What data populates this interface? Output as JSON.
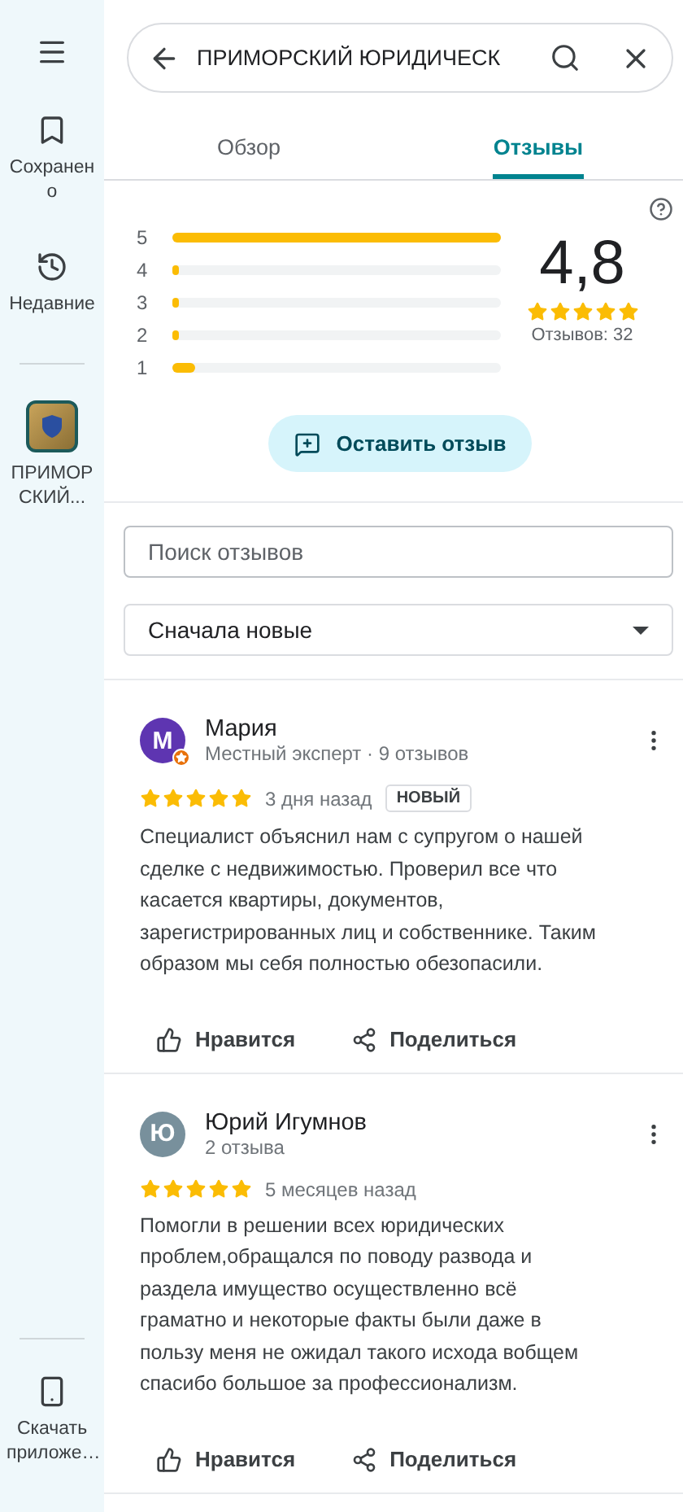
{
  "sidebar": {
    "items": [
      {
        "kind": "menu"
      },
      {
        "kind": "saved",
        "label": "Сохранено"
      },
      {
        "kind": "recent",
        "label": "Недавние"
      },
      {
        "kind": "place",
        "label": "ПРИМОРСКИЙ..."
      }
    ],
    "footer": {
      "label": "Скачать приложе…"
    }
  },
  "search": {
    "value": "ПРИМОРСКИЙ ЮРИДИЧЕСК"
  },
  "tabs": [
    {
      "label": "Обзор",
      "selected": false
    },
    {
      "label": "Отзывы",
      "selected": true
    }
  ],
  "summary": {
    "rating": "4,8",
    "stars": 5,
    "count": "Отзывов: 32",
    "bars": [
      {
        "label": "5",
        "level": 1.0
      },
      {
        "label": "4",
        "level": 0.02
      },
      {
        "label": "3",
        "level": 0.02
      },
      {
        "label": "2",
        "level": 0.02
      },
      {
        "label": "1",
        "level": 0.07
      }
    ],
    "write_button": "Оставить отзыв"
  },
  "review_search": {
    "placeholder": "Поиск отзывов"
  },
  "sort": {
    "value": "Сначала новые"
  },
  "reviews": [
    {
      "avatar": {
        "letter": "М",
        "color": "#5e35b1",
        "local_guide": true
      },
      "name": "Мария",
      "subtitle": "Местный эксперт · 9 отзывов",
      "stars": 5,
      "time": "3 дня назад",
      "badge": "НОВЫЙ",
      "text": "Специалист объяснил нам с супругом о нашей сделке с недвижимостью. Проверил все что касается квартиры, документов, зарегистрированных лиц и собственнике. Таким образом мы себя полностью обезопасили.",
      "actions": [
        "Нравится",
        "Поделиться"
      ]
    },
    {
      "avatar": {
        "letter": "Ю",
        "color": "#78909c",
        "local_guide": false
      },
      "name": "Юрий Игумнов",
      "subtitle": "2 отзыва",
      "stars": 5,
      "time": "5 месяцев назад",
      "text": "Помогли в решении всех юридических проблем,обращался по поводу развода и раздела имущество осуществленно всё граматно и некоторые факты были даже в пользу меня не ожидал такого исхода вобщем спасибо большое за профессионализм.",
      "actions": [
        "Нравится",
        "Поделиться"
      ]
    }
  ]
}
